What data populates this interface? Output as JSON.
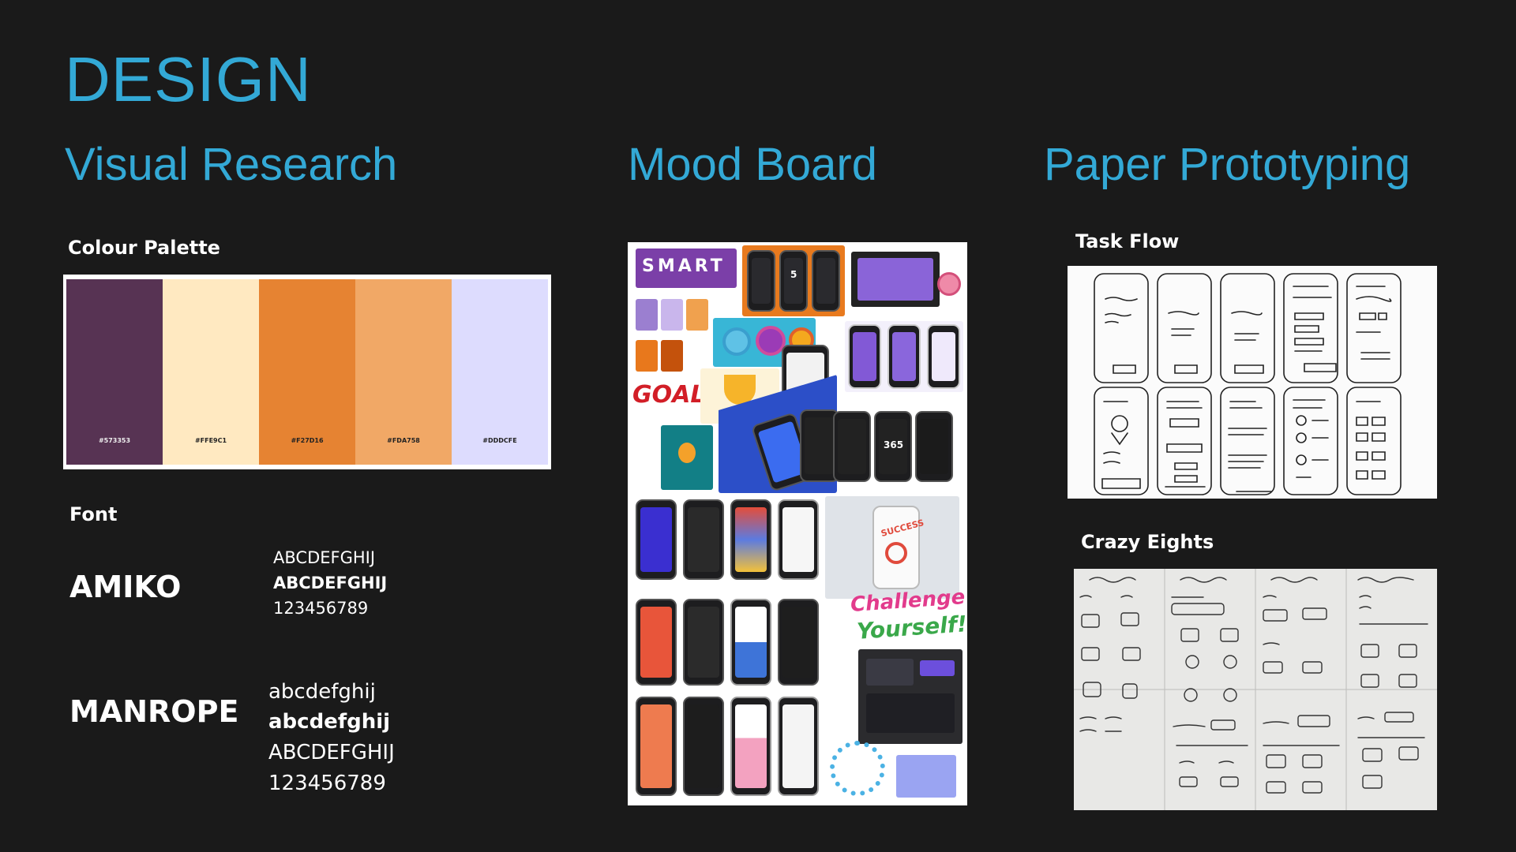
{
  "title": "DESIGN",
  "sections": {
    "visual_research": "Visual Research",
    "mood_board": "Mood Board",
    "paper_prototyping": "Paper Prototyping"
  },
  "colour_palette": {
    "label": "Colour Palette",
    "swatches": [
      {
        "hex": "#573353",
        "label": "#573353"
      },
      {
        "hex": "#FFE9C1",
        "label": "#FFE9C1"
      },
      {
        "hex": "#F27D16",
        "label": "#F27D16"
      },
      {
        "hex": "#FDA758",
        "label": "#FDA758"
      },
      {
        "hex": "#DDDCFE",
        "label": "#DDDCFE"
      }
    ]
  },
  "font": {
    "label": "Font",
    "amiko": {
      "name": "AMIKO",
      "samples": [
        "ABCDEFGHIJ",
        "ABCDEFGHIJ",
        "123456789"
      ]
    },
    "manrope": {
      "name": "MANROPE",
      "samples": [
        "abcdefghij",
        "abcdefghij",
        "ABCDEFGHIJ",
        "123456789"
      ]
    }
  },
  "mood_board": {
    "texts": {
      "smart": "SMART",
      "goal": "GOAL",
      "success": "SUCCESS",
      "challenge": "Challenge",
      "yourself": "Yourself!",
      "streak": "365",
      "five": "5"
    }
  },
  "prototyping": {
    "task_flow_label": "Task Flow",
    "crazy_eights_label": "Crazy Eights"
  },
  "colors": {
    "accent": "#33a9d6",
    "background": "#1a1a1a"
  }
}
